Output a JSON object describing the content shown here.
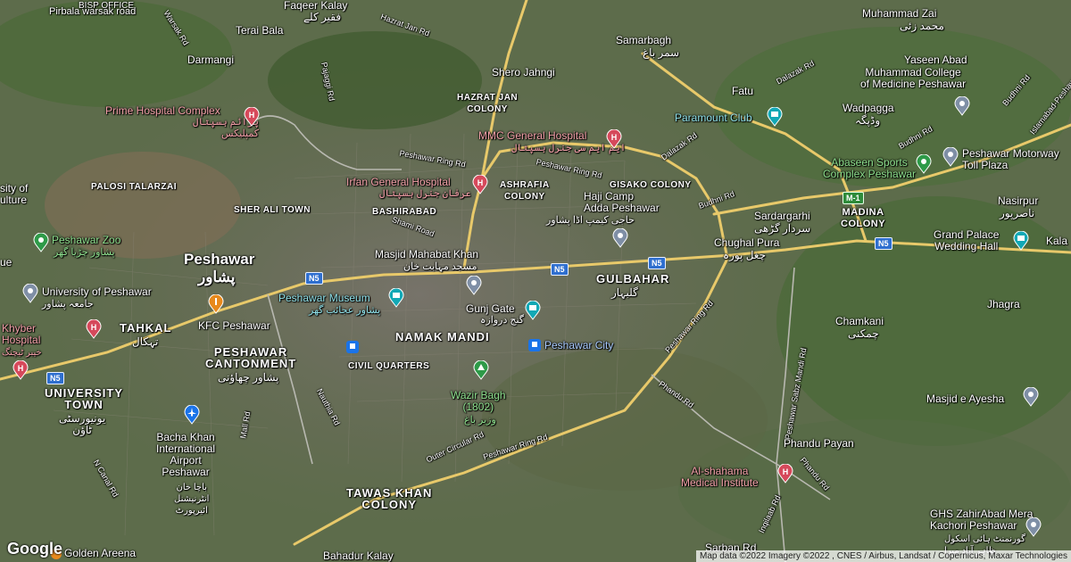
{
  "map": {
    "places": {
      "bisp_office": "BISP OFFICE",
      "pirbala": "Pirbala warsak road",
      "faqeer_kalay": "Faqeer Kalay",
      "faqeer_kalay_ur": "فقیر کلے",
      "hazrat_jan_rd": "Hazrat Jan Rd",
      "muhammad_zai": "Muhammad Zai",
      "muhammad_zai_ur": "محمد زئی",
      "terai_bala": "Terai Bala",
      "samarbagh": "Samarbagh",
      "samarbagh_ur": "سمر باغ",
      "yaseen_abad": "Yaseen Abad",
      "darmangi": "Darmangi",
      "shero_jahngi": "Shero Jahngi",
      "muhammad_college": "Muhammad College\nof Medicine Peshawar",
      "fatu": "Fatu",
      "hazrat_jan_colony": "HAZRAT JAN\nCOLONY",
      "wadpagga": "Wadpagga",
      "wadpagga_ur": "وڈپگہ",
      "prime_hospital": "Prime Hospital Complex",
      "prime_hospital_ur": "پرائم ہسپتال\nکمپلیکس",
      "paramount_club": "Paramount Club",
      "mmc_hospital": "MMC General Hospital",
      "mmc_hospital_ur": "ایم ایم سی جنرل ہسپتال",
      "peshawar_motorway": "Peshawar Motorway\nToll Plaza",
      "abaseen": "Abaseen Sports\nComplex Peshawar",
      "irfan_hospital": "Irfan General Hospital",
      "irfan_hospital_ur": "عرفان جنرل ہسپتال",
      "ashrafia": "ASHRAFIA\nCOLONY",
      "gisako": "GISAKO COLONY",
      "nasirpur": "Nasirpur",
      "nasirpur_ur": "ناصرپور",
      "palosi": "PALOSI TALARZAI",
      "sity_of": "sity of\nulture",
      "haji_camp": "Haji Camp\nAdda Peshawar",
      "haji_camp_ur": "حاجی کیمپ اڈا پشاور",
      "sher_ali": "SHER ALI TOWN",
      "bashirabad": "BASHIRABAD",
      "sardargarhi": "Sardargarhi",
      "sardargarhi_ur": "سردار گڑھی",
      "madina": "MADINA\nCOLONY",
      "grand_palace": "Grand Palace\nWedding Hall",
      "kala": "Kala",
      "peshawar_zoo": "Peshawar Zoo",
      "peshawar_zoo_ur": "پشاور چڑیا گھر",
      "masjid_mahabat": "Masjid Mahabat Khan",
      "masjid_mahabat_ur": "مسجد مہابت خان",
      "chughal_pura": "Chughal Pura",
      "chughal_pura_ur": "چغل پورہ",
      "peshawar": "Peshawar",
      "peshawar_ur": "پشاور",
      "gulbahar": "GULBAHAR",
      "gulbahar_ur": "گلبہار",
      "ue": "ue",
      "university_of_peshawar": "University of Peshawar",
      "university_of_peshawar_ur": "جامعہ پشاور",
      "peshawar_museum": "Peshawar Museum",
      "peshawar_museum_ur": "پشاور عجائب گھر",
      "gunj_gate": "Gunj Gate",
      "gunj_gate_ur": "گنج دروازہ",
      "jhagra": "Jhagra",
      "chamkani": "Chamkani",
      "chamkani_ur": "چمکنی",
      "khyber_hospital": "Khyber\nHospital",
      "khyber_hospital_ur": "خیبر ٹیچنگ",
      "tahkal": "TAHKAL",
      "tahkal_ur": "تہکال",
      "kfc": "KFC Peshawar",
      "namak_mandi": "NAMAK MANDI",
      "peshawar_city": "Peshawar City",
      "cantonment": "PESHAWAR\nCANTONMENT",
      "cantonment_ur": "پشاور چھاؤنی",
      "civil_quarters": "CIVIL QUARTERS",
      "university_town": "UNIVERSITY\nTOWN",
      "university_town_ur": "یونیورسٹی\nٹاؤن",
      "masjid_ayesha": "Masjid e Ayesha",
      "wazir_bagh": "Wazir Bagh\n(1802)",
      "wazir_bagh_ur": "وزیر باغ",
      "bacha_khan": "Bacha Khan\nInternational\nAirport\nPeshawar",
      "bacha_khan_ur": "باچا خان\nانٹرنیشنل\nائیرپورٹ",
      "phandu_payan": "Phandu Payan",
      "al_shahama": "Al-shahama\nMedical Institute",
      "tawas_khan": "TAWAS KHAN\nCOLONY",
      "ghs_zahirabad": "GHS ZahirAbad Mera\nKachori Peshawar",
      "ghs_zahirabad_ur": "گورنمنٹ ہائی اسکول\nظاہر آباد میرا",
      "golden_areena": "Golden Areena",
      "bahadur_kalay": "Bahadur Kalay",
      "sarban_rd": "Sarban Rd"
    },
    "roads": {
      "warsak_rd": "Warsak Rd",
      "pajaggi_rd": "Pajaggi Rd",
      "dalazak_rd_1": "Dalazak Rd",
      "dalazak_rd_2": "Dalazak Rd",
      "budhni_rd_1": "Budhni Rd",
      "budhni_rd_2": "Budhni Rd",
      "islamabad_rd": "Islamabad-Peshawar",
      "ring_rd_1": "Peshawar Ring Rd",
      "ring_rd_2": "Peshawar Ring Rd",
      "ring_rd_3": "Peshawar Ring Rd",
      "ring_rd_4": "Peshawar Ring Rd",
      "shami_rd": "Shami Road",
      "mall_rd": "Mall Rd",
      "nauthia_rd": "Nauthia Rd",
      "canal_rd": "N Canal Rd",
      "outer_circular": "Outer Circular Rd",
      "phandu_rd_1": "Phandu Rd",
      "phandu_rd_2": "Phandu Rd",
      "sabz_mandi_rd": "Peshawar Sabz Mandi Rd",
      "inqilaab_rd": "Inqilaab Rd"
    },
    "shields": {
      "n5": "N5",
      "m1": "M-1"
    },
    "colors": {
      "hospital_pin": "#d6495b",
      "park_pin": "#2e9a48",
      "museum_pin": "#12a8b5",
      "poi_pin": "#7f8fa6",
      "food_pin": "#e8891c",
      "transit_pin": "#1a73e8",
      "highway": "#e8c96a"
    }
  },
  "attribution": "Map data ©2022 Imagery ©2022 , CNES / Airbus, Landsat / Copernicus, Maxar Technologies",
  "logo": "Google"
}
